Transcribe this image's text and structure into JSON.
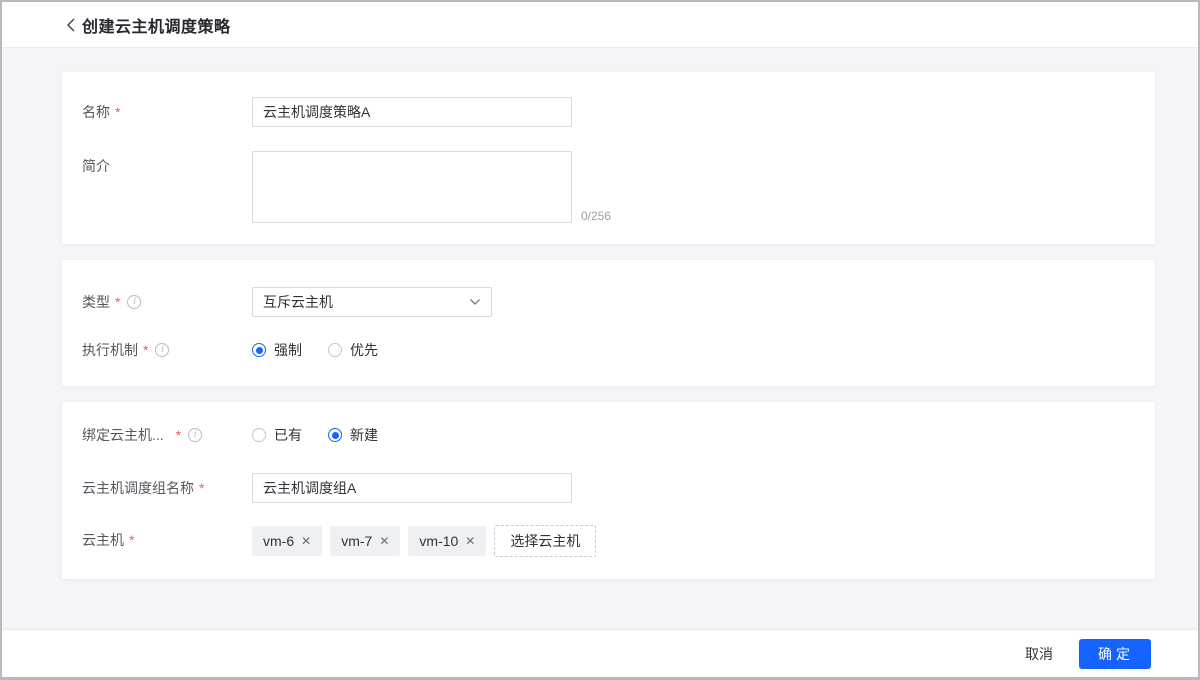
{
  "icons": {
    "back": "back-chevron",
    "info": "i",
    "close": "✕",
    "select_caret": "chevron-down"
  },
  "colors": {
    "accent": "#1664ff",
    "required_mark": "#f2595f",
    "page_background": "#f4f5f9"
  },
  "marks": {
    "required": "*"
  },
  "header": {
    "title": "创建云主机调度策略"
  },
  "form": {
    "basic": {
      "name": {
        "label": "名称",
        "value": "云主机调度策略A",
        "required": true
      },
      "description": {
        "label": "简介",
        "value": "",
        "counter": "0/256",
        "required": false
      }
    },
    "policy": {
      "type": {
        "label": "类型",
        "value": "互斥云主机",
        "required": true,
        "has_info": true
      },
      "mechanism": {
        "label": "执行机制",
        "required": true,
        "has_info": true,
        "options": [
          {
            "label": "强制",
            "selected": true
          },
          {
            "label": "优先",
            "selected": false
          }
        ]
      }
    },
    "binding": {
      "bind_group": {
        "label": "绑定云主机...",
        "required": true,
        "has_info": true,
        "options": [
          {
            "label": "已有",
            "selected": false
          },
          {
            "label": "新建",
            "selected": true
          }
        ]
      },
      "group_name": {
        "label": "云主机调度组名称",
        "value": "云主机调度组A",
        "required": true
      },
      "hosts": {
        "label": "云主机",
        "required": true,
        "tags": [
          "vm-6",
          "vm-7",
          "vm-10"
        ],
        "select_button_label": "选择云主机"
      }
    }
  },
  "footer": {
    "cancel_label": "取消",
    "confirm_label": "确定"
  }
}
